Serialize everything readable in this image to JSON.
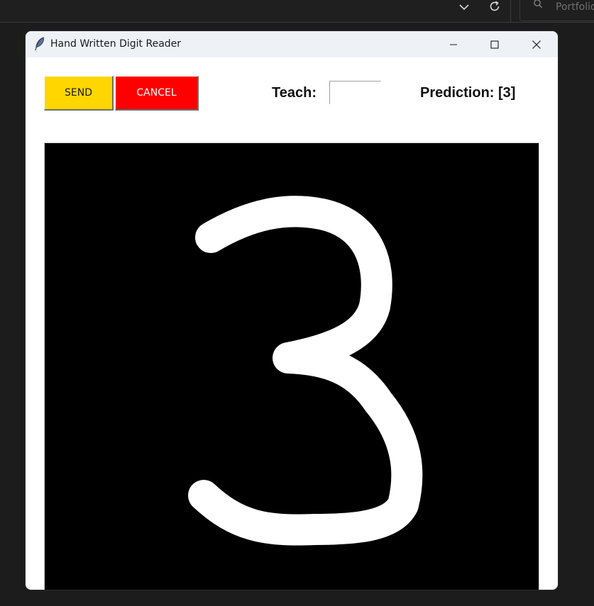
{
  "host": {
    "search_placeholder": "Portfolio",
    "icons": [
      "chevron-down-icon",
      "refresh-icon",
      "search-icon"
    ]
  },
  "window": {
    "title": "Hand Written Digit Reader",
    "icons": [
      "feather-icon",
      "minimize-icon",
      "maximize-icon",
      "close-icon"
    ]
  },
  "toolbar": {
    "send_label": "SEND",
    "cancel_label": "CANCEL",
    "teach_label": "Teach:",
    "teach_value": "",
    "prediction_text": "Prediction: [3]"
  },
  "canvas": {
    "background": "#000000",
    "stroke_color": "#ffffff",
    "drawn_digit": "3"
  },
  "colors": {
    "send_bg": "#ffd600",
    "cancel_bg": "#ff0000",
    "titlebar_bg": "#eef2f7",
    "host_bg": "#1c1c1c"
  }
}
